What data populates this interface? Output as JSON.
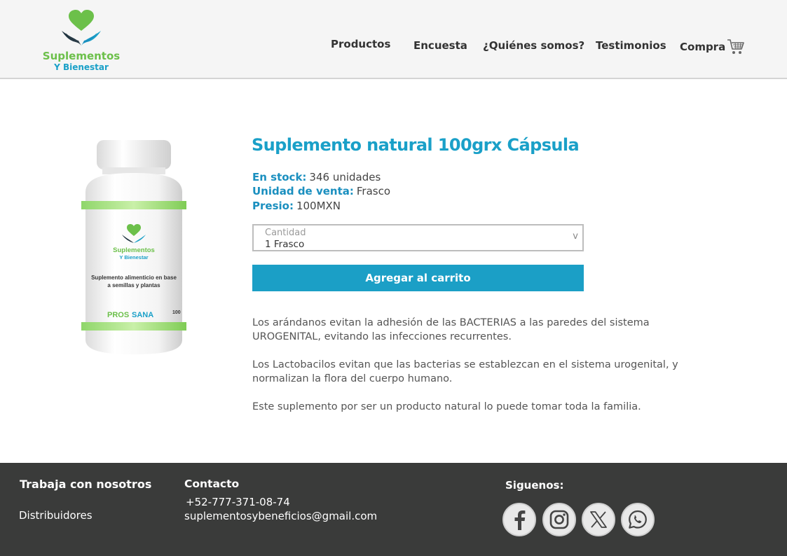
{
  "header": {
    "logo_line1": "Suplementos",
    "logo_line2": "Y Bienestar",
    "nav": {
      "products": "Productos",
      "survey": "Encuesta",
      "about": "¿Quiénes somos?",
      "testimonials": "Testimonios",
      "cart": "Compra"
    }
  },
  "product": {
    "title": "Suplemento natural 100grx Cápsula",
    "stock_label": "En stock:",
    "stock_value": "346 unidades",
    "unit_label": "Unidad de venta:",
    "unit_value": "Frasco",
    "price_label": "Presio:",
    "price_value": "100MXN",
    "quantity_label": "Cantidad",
    "quantity_value": "1  Frasco",
    "quantity_chevron": "v",
    "add_button": "Agregar al carrito",
    "description": [
      "Los arándanos evitan la adhesión de las BACTERIAS a las paredes del sistema UROGENITAL, evitando las infecciones recurrentes.",
      "Los Lactobacilos evitan que las bacterias se establezcan en el sistema urogenital, y normalizan la flora del cuerpo humano.",
      "Este suplemento por ser un producto natural lo puede tomar toda la familia."
    ],
    "bottle_label": {
      "brand1": "Suplementos",
      "brand2": "Y Bienestar",
      "line1": "Suplemento alimenticio en base",
      "line2": "a semillas y plantas",
      "pros": "PROS",
      "sana": "SANA",
      "count": "100"
    }
  },
  "footer": {
    "work_heading": "Trabaja con nosotros",
    "distributors": "Distribuidores",
    "contact_heading": "Contacto",
    "phone": "+52-777-371-08-74",
    "email": "suplementosybeneficios@gmail.com",
    "follow_heading": "Siguenos:",
    "social_icons": [
      "facebook-icon",
      "instagram-icon",
      "x-icon",
      "whatsapp-icon"
    ]
  },
  "colors": {
    "accent_blue": "#1b9fc6",
    "brand_green": "#6cc04a",
    "footer_bg": "#3a3b3a"
  }
}
